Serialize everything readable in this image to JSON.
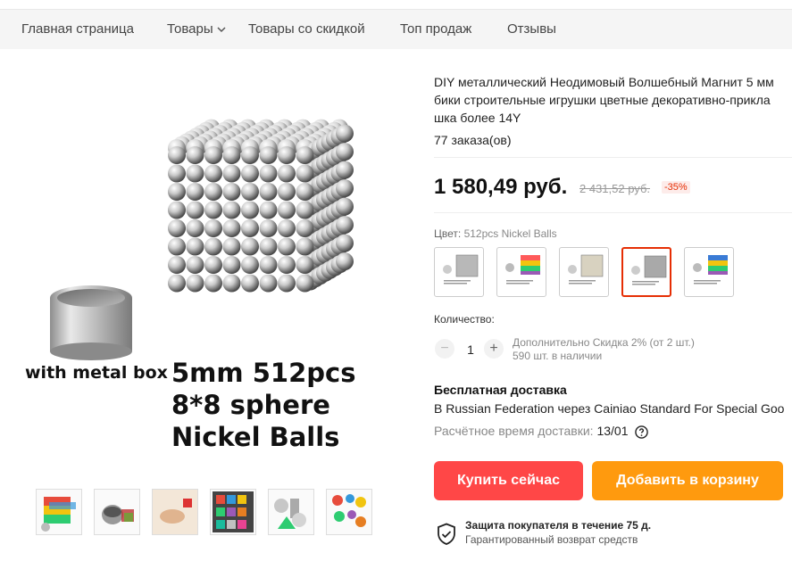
{
  "nav": {
    "items": [
      "Главная страница",
      "Товары",
      "Товары со скидкой",
      "Топ продаж",
      "Отзывы"
    ]
  },
  "gallery": {
    "overlay": {
      "box_caption": "with metal box",
      "line1": "5mm 512pcs",
      "line2": "8*8 sphere",
      "line3": "Nickel Balls"
    },
    "thumbnail_count": 6
  },
  "product": {
    "title": "DIY металлический Неодимовый Волшебный Магнит 5 мм\nбики строительные игрушки цветные декоративно-прикла\nшка более 14Y",
    "orders": "77 заказа(ов)",
    "price": "1 580,49 руб.",
    "old_price": "2 431,52 руб.",
    "discount": "-35%"
  },
  "color": {
    "label": "Цвет:",
    "value": "512pcs Nickel Balls",
    "selected_index": 3,
    "swatches": [
      {
        "kind": "cube",
        "color": "#b8b8b8"
      },
      {
        "kind": "cube-rainbow",
        "color": "#ff5a5a"
      },
      {
        "kind": "cube",
        "color": "#d8d2c0"
      },
      {
        "kind": "cube",
        "color": "#a9a9a9"
      },
      {
        "kind": "cube-rainbow",
        "color": "#3a7bd5"
      }
    ]
  },
  "quantity": {
    "label": "Количество:",
    "value": "1",
    "minus": "−",
    "plus": "+",
    "note1": "Дополнительно Скидка 2% (от 2 шт.)",
    "note2": "590 шт. в наличии"
  },
  "shipping": {
    "title": "Бесплатная доставка",
    "text": "В Russian Federation через Cainiao Standard For Special Goo",
    "time_label": "Расчётное время доставки:",
    "time_value": "13/01"
  },
  "actions": {
    "buy": "Купить сейчас",
    "cart": "Добавить в корзину"
  },
  "protection": {
    "title": "Защита покупателя в течение 75 д.",
    "subtitle": "Гарантированный возврат средств"
  },
  "colors": {
    "buy_button": "#ff4747",
    "cart_button": "#ff9a0e",
    "discount": "#e62e04"
  }
}
